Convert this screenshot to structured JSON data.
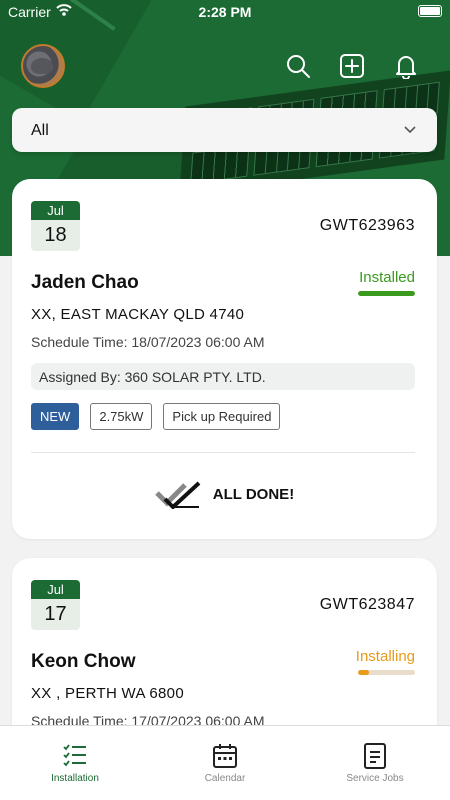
{
  "status_bar": {
    "carrier": "Carrier",
    "time": "2:28 PM"
  },
  "header": {
    "icons": [
      "search-icon",
      "add-icon",
      "bell-icon"
    ],
    "filter": {
      "selected": "All"
    }
  },
  "jobs": [
    {
      "month": "Jul",
      "day": "18",
      "job_id": "GWT623963",
      "customer": "Jaden Chao",
      "status": "Installed",
      "status_color": "#3a9a1e",
      "status_progress": 1.0,
      "address": "XX, EAST MACKAY QLD 4740",
      "schedule": "Schedule Time: 18/07/2023 06:00 AM",
      "assigned": "Assigned By: 360 SOLAR PTY. LTD.",
      "tags": [
        "NEW",
        "2.75kW",
        "Pick up Required"
      ],
      "done_label": "ALL DONE!"
    },
    {
      "month": "Jul",
      "day": "17",
      "job_id": "GWT623847",
      "customer": "Keon Chow",
      "status": "Installing",
      "status_color": "#e89a1a",
      "status_progress": 0.2,
      "address": "XX , PERTH WA 6800",
      "schedule": "Schedule Time: 17/07/2023 06:00 AM"
    }
  ],
  "tabbar": [
    {
      "label": "Installation",
      "icon": "checklist-icon",
      "active": true
    },
    {
      "label": "Calendar",
      "icon": "calendar-icon",
      "active": false
    },
    {
      "label": "Service Jobs",
      "icon": "document-icon",
      "active": false
    }
  ],
  "colors": {
    "brand": "#1c6b34",
    "new_tag": "#2e5f9a"
  }
}
